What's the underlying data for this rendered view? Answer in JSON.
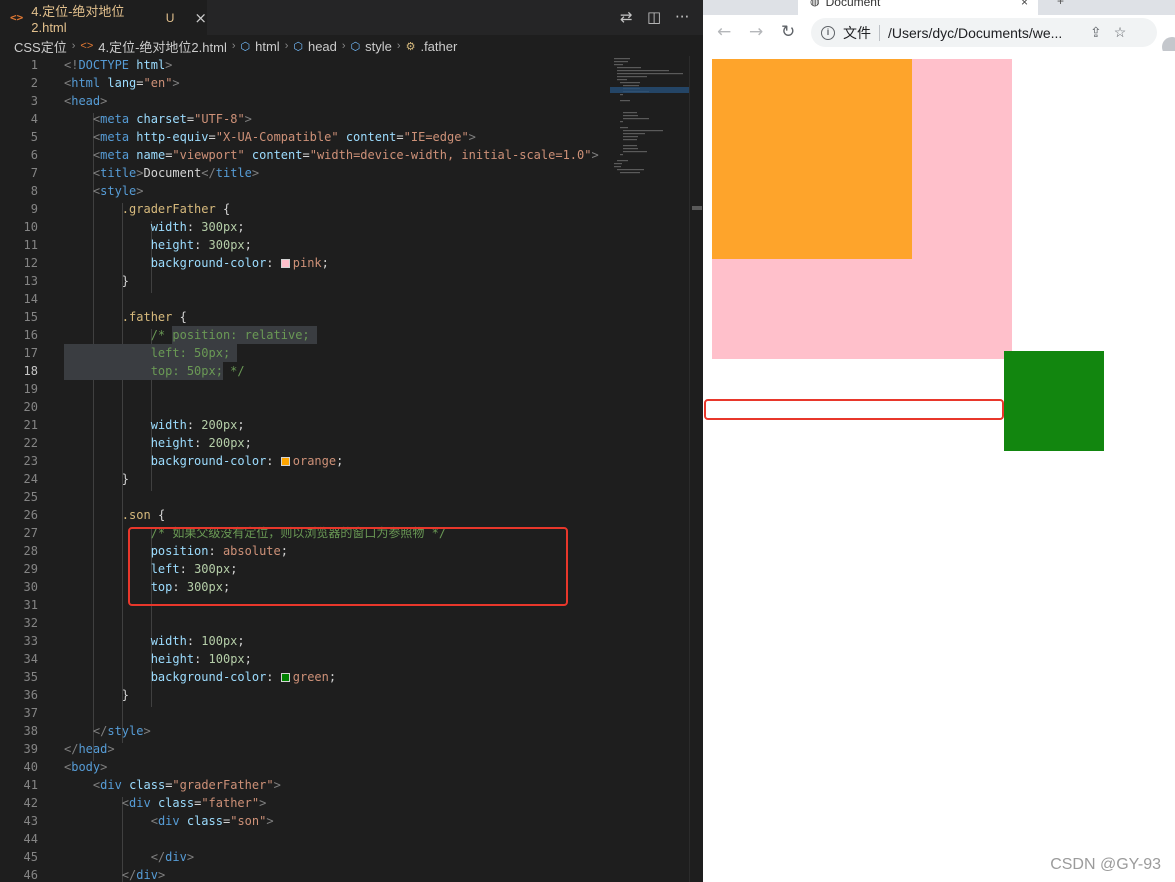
{
  "editor": {
    "tab": {
      "icon": "html-file-icon",
      "label": "4.定位-绝对地位2.html",
      "modified": "U"
    },
    "breadcrumb": [
      "CSS定位",
      "4.定位-绝对地位2.html",
      "html",
      "head",
      "style",
      ".father"
    ],
    "lines": [
      "<!DOCTYPE html>",
      "<html lang=\"en\">",
      "<head>",
      "    <meta charset=\"UTF-8\">",
      "    <meta http-equiv=\"X-UA-Compatible\" content=\"IE=edge\">",
      "    <meta name=\"viewport\" content=\"width=device-width, initial-scale=1.0\">",
      "    <title>Document</title>",
      "    <style>",
      "        .graderFather {",
      "            width: 300px;",
      "            height: 300px;",
      "            background-color: pink;",
      "        }",
      "",
      "        .father {",
      "            /* position: relative;",
      "            left: 50px;",
      "            top: 50px; */",
      "",
      "",
      "            width: 200px;",
      "            height: 200px;",
      "            background-color: orange;",
      "        }",
      "",
      "        .son {",
      "            /* 如果父级没有定位，则以浏览器的窗口为参照物 */",
      "            position: absolute;",
      "            left: 300px;",
      "            top: 300px;",
      "",
      "",
      "            width: 100px;",
      "            height: 100px;",
      "            background-color: green;",
      "        }",
      "",
      "    </style>",
      "</head>",
      "<body>",
      "    <div class=\"graderFather\">",
      "        <div class=\"father\">",
      "            <div class=\"son\">",
      "",
      "            </div>",
      "        </div>"
    ],
    "active_line": 18,
    "colors": {
      "pink": "#ffc0cb",
      "orange": "#ffa500",
      "green": "#008000",
      "highlight": "#e8372b"
    }
  },
  "browser": {
    "tab_title": "Document",
    "scheme_label": "文件",
    "url": "/Users/dyc/Documents/we...",
    "preview": {
      "graderFather_color": "#ffc0cb",
      "father_color": "#fea42b",
      "son_color": "#12860f"
    }
  },
  "watermark": "CSDN @GY-93"
}
